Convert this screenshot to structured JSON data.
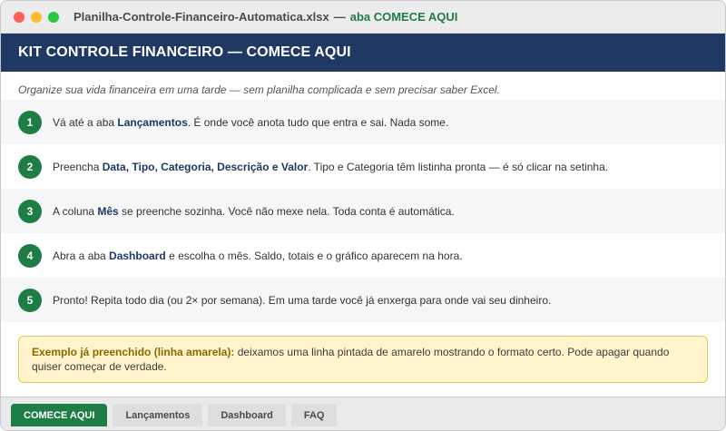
{
  "window": {
    "file_name": "Planilha-Controle-Financeiro-Automatica.xlsx",
    "separator": "—",
    "sheet_label": "aba COMECE AQUI"
  },
  "banner": {
    "title": "KIT CONTROLE FINANCEIRO — COMECE AQUI"
  },
  "intro": "Organize sua vida financeira em uma tarde — sem planilha complicada e sem precisar saber Excel.",
  "steps": [
    {
      "number": "1",
      "pre": "Vá até a aba ",
      "bold": "Lançamentos",
      "post": ". É onde você anota tudo que entra e sai. Nada some."
    },
    {
      "number": "2",
      "pre": "Preencha ",
      "bold": "Data, Tipo, Categoria, Descrição e Valor",
      "post": ". Tipo e Categoria têm listinha pronta — é só clicar na setinha."
    },
    {
      "number": "3",
      "pre": "A coluna ",
      "bold": "Mês",
      "post": " se preenche sozinha. Você não mexe nela. Toda conta é automática."
    },
    {
      "number": "4",
      "pre": "Abra a aba ",
      "bold": "Dashboard",
      "post": " e escolha o mês. Saldo, totais e o gráfico aparecem na hora."
    },
    {
      "number": "5",
      "pre": "Pronto! Repita todo dia (ou 2× por semana). Em uma tarde você já enxerga para onde vai seu dinheiro.",
      "bold": "",
      "post": ""
    }
  ],
  "note": {
    "bold": "Exemplo já preenchido (linha amarela):",
    "text": " deixamos uma linha pintada de amarelo mostrando o formato certo. Pode apagar quando quiser começar de verdade."
  },
  "tabs": [
    {
      "label": "COMECE AQUI",
      "active": true
    },
    {
      "label": "Lançamentos",
      "active": false
    },
    {
      "label": "Dashboard",
      "active": false
    },
    {
      "label": "FAQ",
      "active": false
    }
  ],
  "colors": {
    "banner": "#1f3864",
    "accent_green": "#1e7d45",
    "note_background": "#fff4cc",
    "note_border": "#e3c561"
  }
}
